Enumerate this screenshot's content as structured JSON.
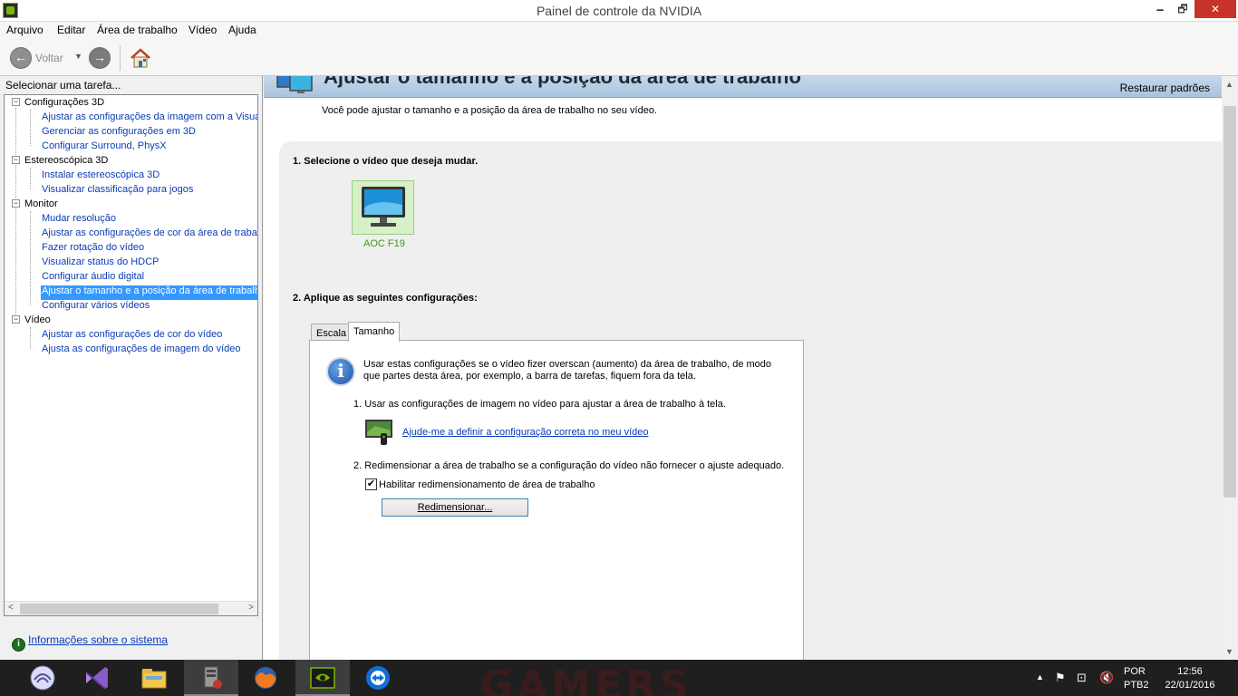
{
  "window": {
    "title": "Painel de controle da NVIDIA",
    "minimize_glyph": "🗕",
    "maximize_glyph": "🗗",
    "close_glyph": "✕"
  },
  "menu": [
    "Arquivo",
    "Editar",
    "Área de trabalho",
    "Vídeo",
    "Ajuda"
  ],
  "toolbar": {
    "back_label": "Voltar",
    "back_glyph": "←",
    "forward_glyph": "→",
    "dropdown_glyph": "▼"
  },
  "left_panel": {
    "task_label": "Selecionar uma tarefa...",
    "tree": [
      {
        "category": "Configurações 3D",
        "items": [
          "Ajustar as configurações da imagem com a Visuali",
          "Gerenciar as configurações em 3D",
          "Configurar Surround, PhysX"
        ]
      },
      {
        "category": "Estereoscópica 3D",
        "items": [
          "Instalar estereoscópica 3D",
          "Visualizar classificação para jogos"
        ]
      },
      {
        "category": "Monitor",
        "items": [
          "Mudar resolução",
          "Ajustar as configurações de cor da área de trabal",
          "Fazer rotação do vídeo",
          "Visualizar status do HDCP",
          "Configurar áudio digital",
          "Ajustar o tamanho e a posição da área de trabalh",
          "Configurar vários vídeos"
        ]
      },
      {
        "category": "Vídeo",
        "items": [
          "Ajustar as configurações de cor do vídeo",
          "Ajusta as configurações de imagem do vídeo"
        ]
      }
    ],
    "expander_glyph": "−",
    "scroll_left_glyph": "<",
    "scroll_right_glyph": ">",
    "sysinfo_link": "Informações sobre o sistema",
    "sysinfo_glyph": "i"
  },
  "main": {
    "heading": "Ajustar o tamanho e a posição da área de trabalho",
    "restore_defaults": "Restaurar padrões",
    "intro": "Você pode ajustar o tamanho e a posição da área de trabalho no seu vídeo.",
    "step1": "1. Selecione o vídeo que deseja mudar.",
    "monitor_name": "AOC F19",
    "step2": "2. Aplique as seguintes configurações:",
    "tabs": [
      "Escala",
      "Tamanho"
    ],
    "info_glyph": "i",
    "info_text": "Usar estas configurações se o vídeo fizer overscan (aumento) da área de trabalho, de modo que partes desta área, por exemplo, a barra de tarefas, fiquem fora da tela.",
    "option1": "1. Usar as configurações de imagem no vídeo para ajustar a área de trabalho à tela.",
    "help_link": "Ajude-me a definir a configuração correta no meu vídeo",
    "option2": "2. Redimensionar a área de trabalho se a configuração do vídeo não fornecer o ajuste adequado.",
    "checkbox_label": "Habilitar redimensionamento de área de trabalho",
    "checkbox_checked": true,
    "checkbox_glyph": "✔",
    "resize_button": "Redimensionar...",
    "scroll_up_glyph": "▲",
    "scroll_down_glyph": "▼"
  },
  "taskbar": {
    "background_text": "GAMERS",
    "apps": [
      "bittorrent-icon",
      "visual-studio-icon",
      "file-explorer-icon",
      "media-player-icon",
      "firefox-icon",
      "nvidia-icon",
      "teamviewer-icon"
    ],
    "tray": {
      "arrow_glyph": "▲",
      "flag_glyph": "⚑",
      "network_glyph": "⊡",
      "volume_glyph": "🔇",
      "lang_top": "POR",
      "lang_bottom": "PTB2",
      "time": "12:56",
      "date": "22/01/2016"
    }
  }
}
